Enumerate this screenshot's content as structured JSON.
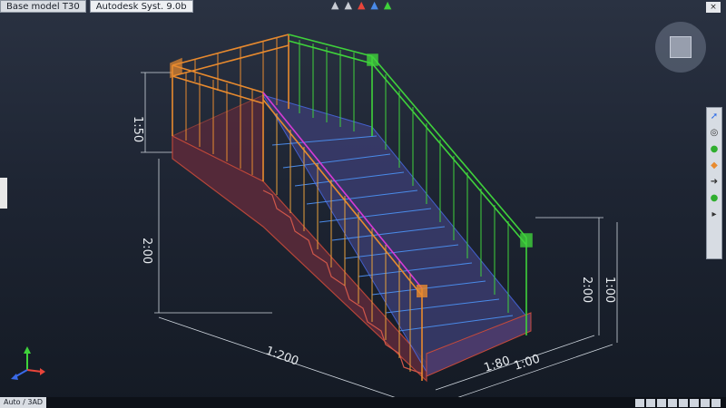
{
  "window": {
    "tabs": [
      "Base model T30",
      "Autodesk Syst. 9.0b"
    ],
    "close_label": "×"
  },
  "status": {
    "tab_label": "Auto / 3AD"
  },
  "dimensions": {
    "height_upper": "1:50",
    "height_lower": "2:00",
    "height_right_a": "2:00",
    "height_right_b": "1:00",
    "length_main": "1:200",
    "length_right_a": "1:80",
    "length_right_b": "1:00"
  },
  "navbar_icons": [
    "pan-icon",
    "orbit-icon",
    "zoom-icon",
    "steering-icon",
    "walk-icon",
    "look-icon",
    "showmotion-icon"
  ],
  "colors": {
    "stringer": "#c84a3a",
    "stair_fill": "#3a3c6e",
    "rail_orange": "#e88a2e",
    "rail_green": "#3fd23b",
    "rail_magenta": "#d63bd6",
    "tread_blue": "#4a8ae8",
    "background": "#1e2533"
  }
}
